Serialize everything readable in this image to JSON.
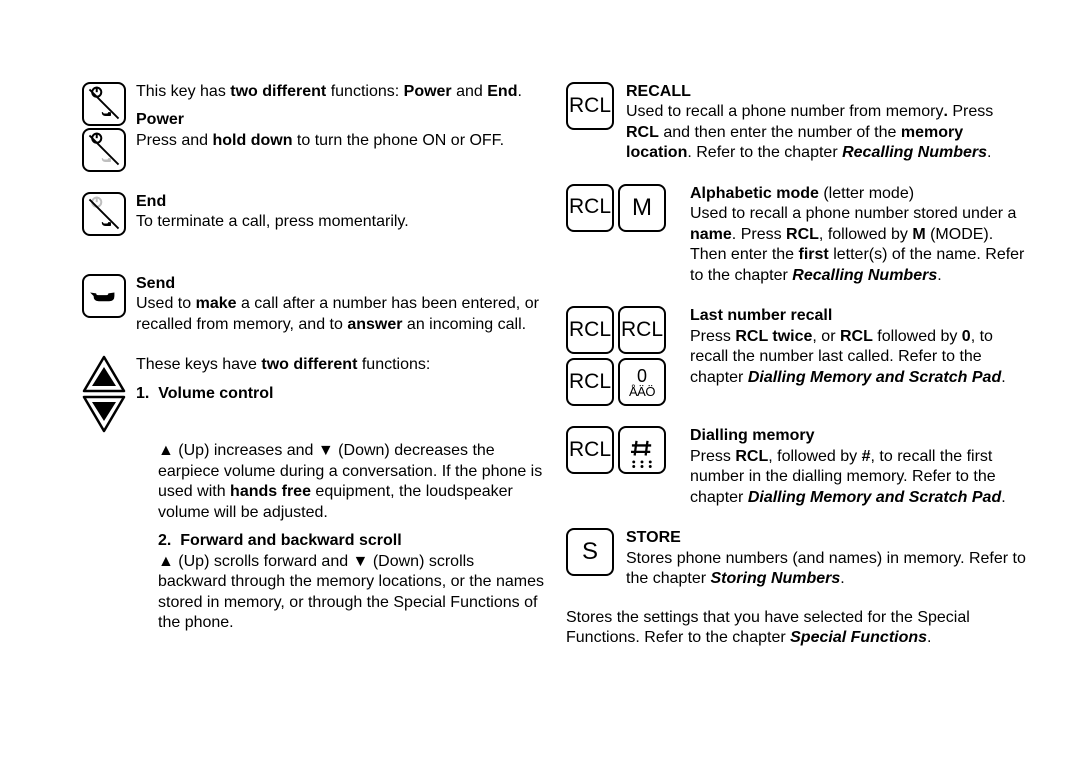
{
  "left": {
    "powerEnd": {
      "text_a": "This key has ",
      "text_b": "two different",
      "text_c": " functions: ",
      "text_d": "Power",
      "text_e": " and ",
      "text_f": "End",
      "text_g": "."
    },
    "power": {
      "title": "Power",
      "body_a": "Press and ",
      "body_b": "hold down",
      "body_c": " to turn the phone ON or OFF."
    },
    "end": {
      "title": "End",
      "body": "To terminate a call, press momentarily."
    },
    "send": {
      "title": "Send",
      "body_a": "Used to ",
      "body_b": "make",
      "body_c": " a call after a number has been entered, or recalled from memory, and to ",
      "body_d": "answer",
      "body_e": " an incoming call."
    },
    "twofunc": {
      "intro_a": "These keys have ",
      "intro_b": "two different",
      "intro_c": " functions:",
      "vol_num": "1.",
      "vol_title": "Volume control",
      "vol_a": "▲ (Up) increases and ▼ (Down) decreases the earpiece volume during a conversation. If the phone is used with ",
      "vol_b": "hands free",
      "vol_c": " equipment, the loudspeaker volume will be adjusted.",
      "scr_num": "2.",
      "scr_title": "Forward and backward scroll",
      "scr_body": "▲ (Up) scrolls forward and ▼ (Down) scrolls backward through the memory locations, or the names stored in memory, or through the Special Functions of the phone."
    }
  },
  "right": {
    "recall": {
      "title": "RECALL",
      "a": "Used to recall a phone number from memory",
      "b": ".",
      "c": " Press ",
      "d": "RCL",
      "e": " and then enter the number of the ",
      "f": "memory location",
      "g": ". Refer to the chapter ",
      "chap": "Recalling Numbers",
      "h": "."
    },
    "alpha": {
      "title": "Alphabetic mode",
      "paren": " (letter mode)",
      "a": "Used to recall a phone number stored under a ",
      "b": "name",
      "c": ". Press ",
      "d": "RCL",
      "e": ", followed by ",
      "f": "M",
      "g": " (MODE). Then enter the ",
      "h": "first",
      "i": " letter(s) of the name. Refer to the chapter ",
      "chap": "Recalling Numbers",
      "j": "."
    },
    "lastnum": {
      "title": "Last number recall",
      "a": "Press ",
      "b": "RCL twice",
      "c": ", or ",
      "d": "RCL",
      "e": " followed by ",
      "f": "0",
      "g": ", to recall the number last called. Refer to the chapter ",
      "chap": "Dialling Memory and Scratch Pad",
      "h": "."
    },
    "dialmem": {
      "title": "Dialling memory",
      "a": "Press ",
      "b": "RCL",
      "c": ", followed by ",
      "d": "#",
      "e": ", to recall the first number in the dialling memory. Refer to the chapter ",
      "chap": "Dialling Memory and Scratch Pad",
      "f": "."
    },
    "store": {
      "title": "STORE",
      "a": "Stores phone numbers (and names) in memory. Refer to the chapter ",
      "chap": "Storing Numbers",
      "b": "."
    },
    "final": {
      "a": "Stores the settings that you have selected for the Special Functions. Refer to the chapter ",
      "chap": "Special Functions",
      "b": "."
    },
    "keys": {
      "rcl": "RCL",
      "m": "M",
      "zero_top": "0",
      "zero_bot": "ÅÄÖ",
      "hash_dots": "⠶",
      "s": "S"
    }
  }
}
